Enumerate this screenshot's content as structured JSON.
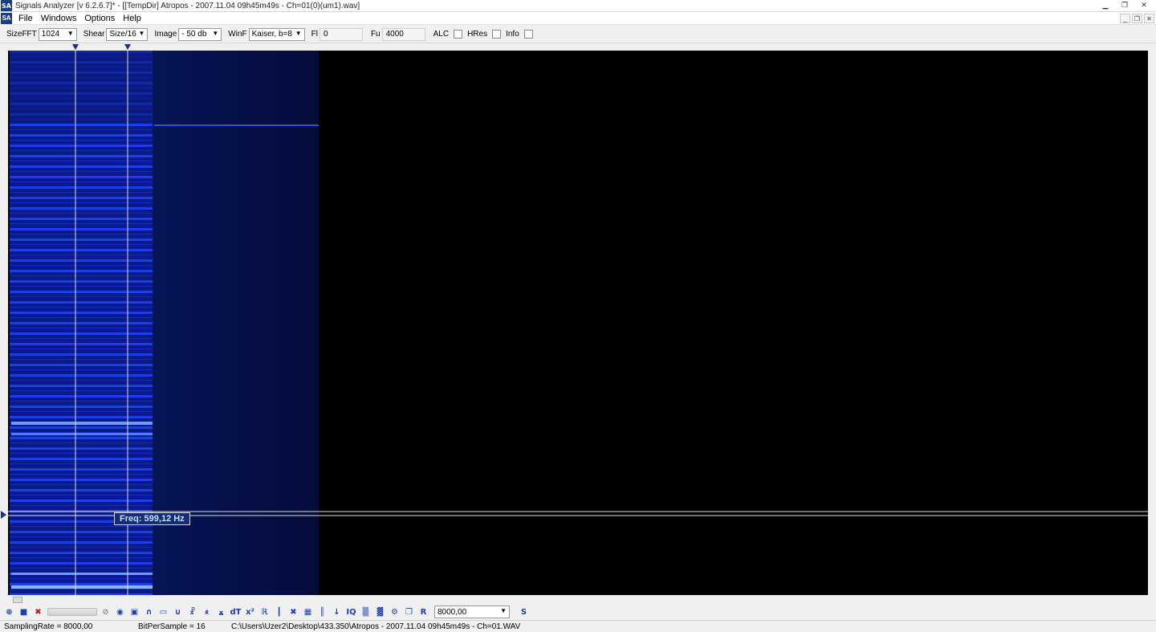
{
  "window": {
    "title": "Signals Analyzer [v 6.2.6.7]* - [[TempDir] Atropos - 2007.11.04 09h45m49s - Ch=01(0)(um1).wav]",
    "logo": "SA"
  },
  "menu": {
    "items": [
      "File",
      "Windows",
      "Options",
      "Help"
    ]
  },
  "toolbar": {
    "sizefft_label": "SizeFFT",
    "sizefft_value": "1024",
    "shear_label": "Shear",
    "shear_value": "Size/16",
    "image_label": "Image",
    "image_value": "- 50 db",
    "winf_label": "WinF",
    "winf_value": "Kaiser, b=8",
    "fl_label": "Fl",
    "fl_value": "0",
    "fu_label": "Fu",
    "fu_value": "4000",
    "alc_label": "ALC",
    "hres_label": "HRes",
    "info_label": "Info"
  },
  "spectrogram": {
    "freq_readout": "Freq: 599,12 Hz",
    "colors": {
      "background": "#000000",
      "signal": "#1a3cff",
      "cursor": "#dcdcdc"
    }
  },
  "bottom_toolbar": {
    "rate_value": "8000,00",
    "icons": [
      "zoom-icon",
      "stop-icon",
      "close-icon",
      "disabled-icon",
      "speaker-icon",
      "square-icon",
      "arc-up-icon",
      "rect-icon",
      "arc-down-icon",
      "tree-icon",
      "merge-icon",
      "split-icon",
      "dt-icon",
      "x2-icon",
      "r-icon",
      "bars-icon",
      "cross-icon",
      "grid-icon",
      "columns-icon",
      "fq-icon",
      "iq-icon",
      "pattern1-icon",
      "pattern2-icon",
      "gear-icon",
      "copy-icon",
      "r-letter-icon",
      "s-letter-icon"
    ]
  },
  "status": {
    "sampling_rate": "SamplingRate = 8000,00",
    "bit_per_sample": "BitPerSample = 16",
    "file_path": "C:\\Users\\Uzer2\\Desktop\\433.350\\Atropos - 2007.11.04 09h45m49s - Ch=01.WAV"
  }
}
